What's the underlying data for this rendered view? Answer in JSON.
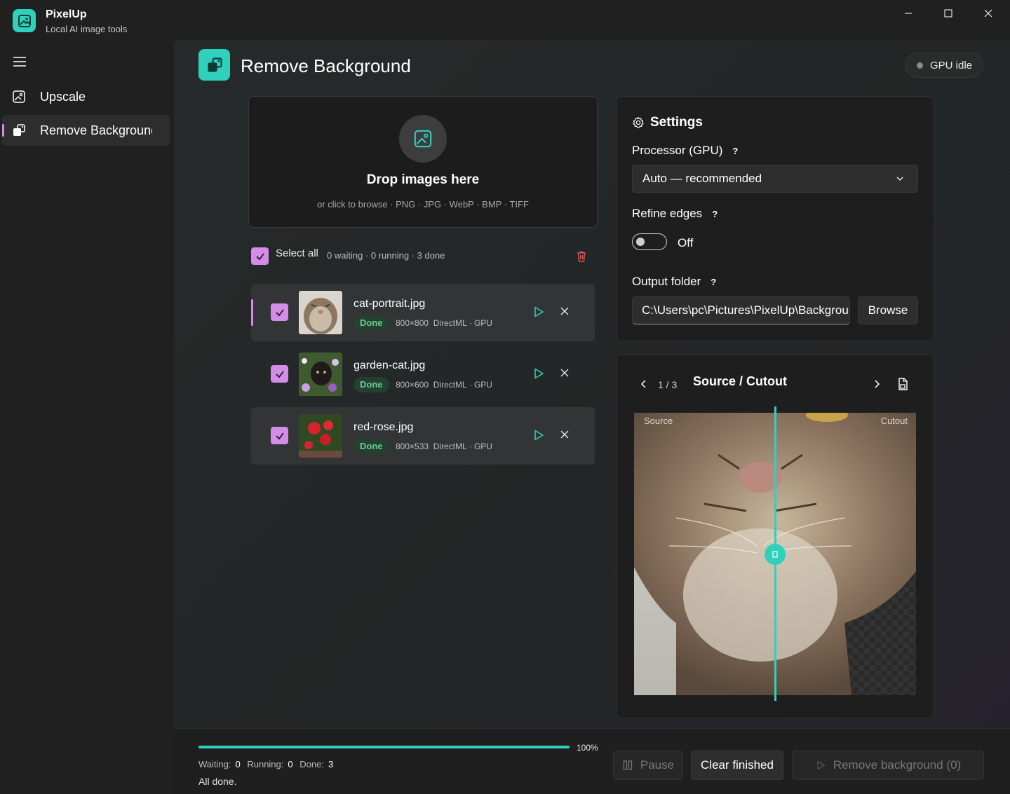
{
  "app": {
    "name": "PixelUp",
    "subtitle": "Local AI image tools"
  },
  "window": {
    "controls": [
      "minimize-icon",
      "maximize-icon",
      "close-icon"
    ]
  },
  "nav": {
    "items": [
      {
        "label": "Upscale",
        "icon": "image-icon",
        "active": false
      },
      {
        "label": "Remove Background",
        "icon": "remove-bg-icon",
        "active": true
      }
    ]
  },
  "page": {
    "title": "Remove Background",
    "gpu_status": "GPU idle"
  },
  "dropzone": {
    "title": "Drop images here",
    "subtitle": "or click to browse · PNG · JPG · WebP · BMP · TIFF"
  },
  "queue": {
    "select_all_label": "Select all",
    "status": "0 waiting · 0 running · 3 done",
    "items": [
      {
        "name": "cat-portrait.jpg",
        "status": "Done",
        "size": "800×800",
        "engine": "DirectML · GPU",
        "checked": true
      },
      {
        "name": "garden-cat.jpg",
        "status": "Done",
        "size": "800×600",
        "engine": "DirectML · GPU",
        "checked": true
      },
      {
        "name": "red-rose.jpg",
        "status": "Done",
        "size": "800×533",
        "engine": "DirectML · GPU",
        "checked": true
      }
    ]
  },
  "settings": {
    "title": "Settings",
    "processor_label": "Processor (GPU)",
    "processor_value": "Auto — recommended",
    "refine_label": "Refine edges",
    "refine_value": "Off",
    "output_label": "Output folder",
    "output_path": "C:\\Users\\pc\\Pictures\\PixelUp\\Background",
    "browse_label": "Browse",
    "help_glyph": "?"
  },
  "preview": {
    "counter": "1 / 3",
    "title": "Source / Cutout",
    "source_label": "Source",
    "cutout_label": "Cutout"
  },
  "footer": {
    "progress": 100,
    "progress_label": "100%",
    "waiting_label": "Waiting:",
    "waiting": "0",
    "running_label": "Running:",
    "running": "0",
    "done_label": "Done:",
    "done": "3",
    "status_text": "All done.",
    "pause_label": "Pause",
    "clear_label": "Clear finished",
    "remove_label": "Remove background (0)"
  },
  "colors": {
    "accent": "#2fd1bd",
    "checkbox": "#d58be8",
    "success": "#5fd38d",
    "danger": "#e06060"
  }
}
